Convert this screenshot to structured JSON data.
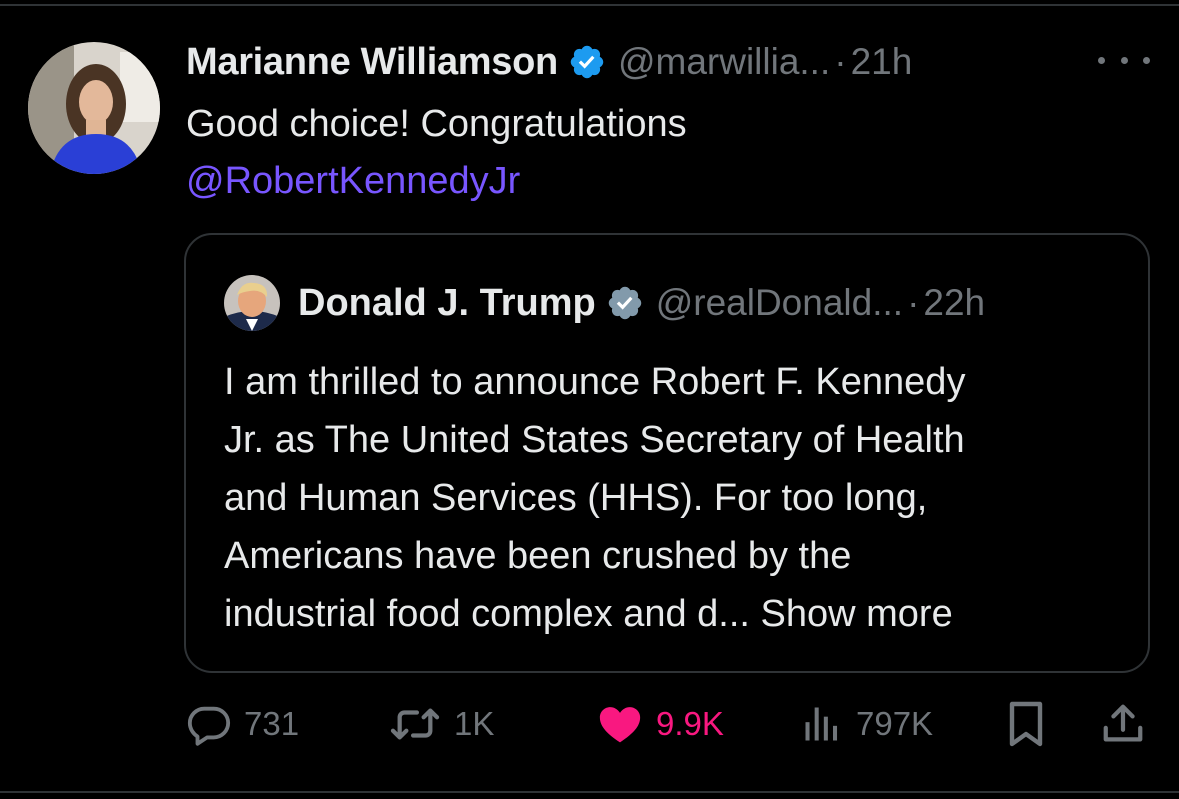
{
  "tweet": {
    "author_name": "Marianne Williamson",
    "handle": "@marwillia...",
    "separator": "·",
    "time": "21h",
    "text": "Good choice! Congratulations",
    "mention": "@RobertKennedyJr"
  },
  "quoted": {
    "author_name": "Donald J. Trump",
    "handle": "@realDonald...",
    "separator": "·",
    "time": "22h",
    "lines": [
      "I am thrilled to announce Robert F. Kennedy",
      "Jr. as The United States Secretary of Health",
      "and Human Services (HHS). For too long,",
      "Americans have been crushed by the",
      "industrial food complex and d... "
    ],
    "show_more": "Show more"
  },
  "actions": {
    "replies": "731",
    "reposts": "1K",
    "likes": "9.9K",
    "views": "797K"
  },
  "icons": {
    "verified": "verified-badge-icon",
    "more": "more-icon",
    "reply": "reply-icon",
    "repost": "repost-icon",
    "like": "heart-icon",
    "views": "views-icon",
    "bookmark": "bookmark-icon",
    "share": "share-icon"
  },
  "colors": {
    "background": "#000000",
    "text": "#e7e9ea",
    "secondary": "#71767b",
    "mention": "#7856ff",
    "like": "#f91880",
    "verified": "#1d9bf0",
    "quote_verified": "#829aab",
    "border": "#2f3336"
  }
}
